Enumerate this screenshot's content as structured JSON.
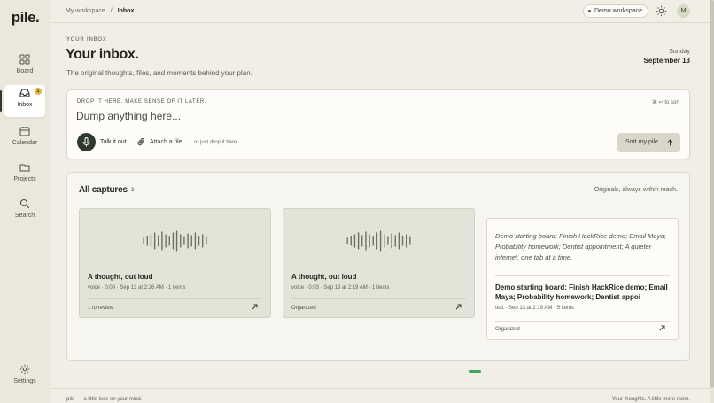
{
  "app": {
    "logo": "pile."
  },
  "sidebar": {
    "items": [
      {
        "label": "Board",
        "icon": "grid-icon"
      },
      {
        "label": "Inbox",
        "icon": "inbox-icon",
        "badge": "1",
        "active": true
      },
      {
        "label": "Calendar",
        "icon": "calendar-icon"
      },
      {
        "label": "Projects",
        "icon": "folder-icon"
      },
      {
        "label": "Search",
        "icon": "search-icon"
      }
    ],
    "settings_label": "Settings"
  },
  "topbar": {
    "breadcrumb": {
      "root": "My workspace",
      "separator": "/",
      "current": "Inbox"
    },
    "workspace_pill": "Demo workspace",
    "avatar_initial": "M"
  },
  "header": {
    "eyebrow": "YOUR INBOX",
    "title": "Your inbox.",
    "subtitle": "The original thoughts, files, and moments behind your plan.",
    "day": "Sunday",
    "date": "September 13"
  },
  "dump": {
    "eyebrow": "DROP IT HERE. MAKE SENSE OF IT LATER.",
    "shortcut_hint": "⌘ ↵ to sort",
    "placeholder": "Dump anything here...",
    "talk_label": "Talk it out",
    "attach_label": "Attach a file",
    "drop_note": "or just drop it here",
    "sort_label": "Sort my pile"
  },
  "captures": {
    "heading": "All captures",
    "count": "3",
    "note": "Originals, always within reach.",
    "cards": [
      {
        "kind": "voice",
        "title": "A thought, out loud",
        "meta": "voice · 0:09 · Sep 13 at 2:26 AM · 1 items",
        "status": "1 to review"
      },
      {
        "kind": "voice",
        "title": "A thought, out loud",
        "meta": "voice · 0:03 · Sep 13 at 2:19 AM · 1 items",
        "status": "Organized"
      },
      {
        "kind": "text",
        "quote": "Demo starting board: Finish HackRice demo; Email Maya; Probability homework; Dentist appointment; A quieter internet, one tab at a time.",
        "title": "Demo starting board: Finish HackRice demo; Email Maya; Probability homework; Dentist appoi",
        "meta": "text · Sep 13 at 2:19 AM · 5 items",
        "status": "Organized"
      }
    ]
  },
  "footer": {
    "brand": "pile",
    "tagline": "a little less on your mind.",
    "right": "Your thoughts. A little more room."
  },
  "colors": {
    "background": "#f1eee6",
    "sidebar": "#ebe7dd",
    "accent_dark": "#2f3a2d",
    "badge": "#e2b837",
    "voice_card": "#e3e4d8",
    "progress_dot": "#3aa55e"
  }
}
